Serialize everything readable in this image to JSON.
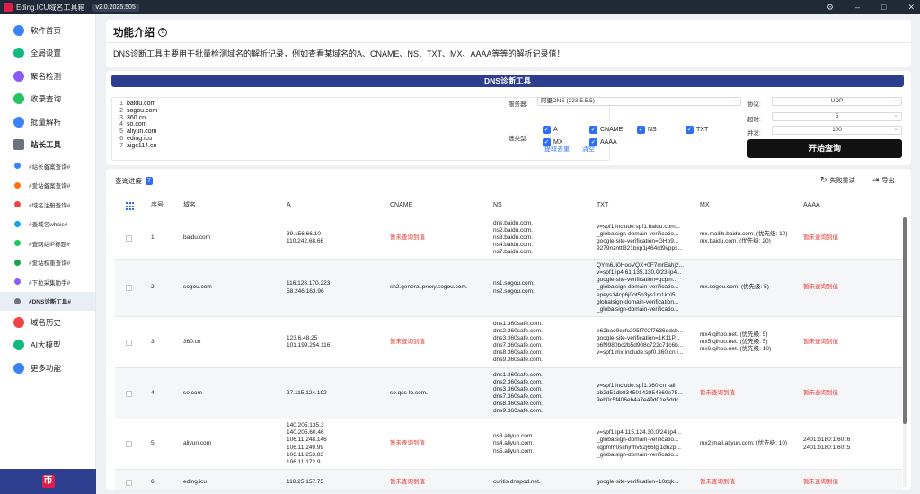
{
  "titlebar": {
    "title": "Eding.ICU域名工具箱",
    "version": "v2.0.2025.505"
  },
  "sidebar": {
    "items": [
      {
        "label": "软件首页",
        "color": "#3b82f6"
      },
      {
        "label": "全局设置",
        "color": "#10b981"
      },
      {
        "label": "聚名检测",
        "color": "#8b5cf6"
      },
      {
        "label": "收录查询",
        "color": "#22c55e"
      },
      {
        "label": "批量解析",
        "color": "#3b82f6"
      }
    ],
    "group_label": "站长工具",
    "subitems": [
      {
        "label": "#站长备案查询#",
        "color": "#3b82f6"
      },
      {
        "label": "#爱站备案查询#",
        "color": "#f97316"
      },
      {
        "label": "#域名注册查询#",
        "color": "#ef4444"
      },
      {
        "label": "#查域名whois#",
        "color": "#0ea5e9"
      },
      {
        "label": "#查网站IP标题#",
        "color": "#22c55e"
      },
      {
        "label": "#爱站权重查询#",
        "color": "#16a34a"
      },
      {
        "label": "#下拉采集助手#",
        "color": "#8b5cf6"
      },
      {
        "label": "#DNS诊断工具#",
        "color": "#6b7280"
      }
    ],
    "bottom_items": [
      {
        "label": "域名历史",
        "color": "#ef4444"
      },
      {
        "label": "AI大模型",
        "color": "#10b981"
      },
      {
        "label": "更多功能",
        "color": "#3b82f6"
      }
    ]
  },
  "intro": {
    "title": "功能介绍",
    "desc": "DNS诊断工具主要用于批量检测域名的解析记录，例如查看某域名的A、CNAME、NS、TXT、MX、AAAA等等的解析记录值！"
  },
  "tool": {
    "title": "DNS诊断工具",
    "line_numbers": [
      "1",
      "2",
      "3",
      "4",
      "5",
      "6",
      "7"
    ],
    "domains": [
      "baidu.com",
      "sogou.com",
      "360.cn",
      "so.com",
      "aliyun.com",
      "eding.icu",
      "aigc114.cn"
    ],
    "extract_label": "提取去重",
    "clear_label": "清空",
    "server_label": "服务器:",
    "server_value": "阿里DNS (223.5.5.5)",
    "protocol_label": "协议:",
    "protocol_value": "UDP",
    "timeout_label": "超时:",
    "timeout_value": "5",
    "concurrency_label": "并发:",
    "concurrency_value": "100",
    "record_type_label": "选类型:",
    "record_types": [
      "A",
      "CNAME",
      "NS",
      "TXT",
      "MX",
      "AAAA"
    ],
    "start_label": "开始查询"
  },
  "results": {
    "progress_label": "查询进度",
    "progress_count": "7",
    "retry_label": "失败重试",
    "export_label": "导出",
    "columns": [
      "序号",
      "域名",
      "A",
      "CNAME",
      "NS",
      "TXT",
      "MX",
      "AAAA"
    ],
    "rows": [
      {
        "idx": "1",
        "domain": "baidu.com",
        "a": [
          "39.156.66.10",
          "110.242.68.66"
        ],
        "cname": [
          "暂未查询到值"
        ],
        "ns": [
          "dns.baidu.com.",
          "ns2.baidu.com.",
          "ns3.baidu.com.",
          "ns4.baidu.com.",
          "ns7.baidu.com."
        ],
        "txt": [
          "v=spf1 include:spf1.baidu.com...",
          "_globalsign-domain-verificatio...",
          "google-site-verification=GHb9...",
          "9279nznttl321bxp1j464rd9vpps..."
        ],
        "mx": [
          "mx.maillb.baidu.com. (优先级: 10)",
          "mx.baidu.com. (优先级: 20)"
        ],
        "aaaa": [
          "暂未查询到值"
        ]
      },
      {
        "idx": "2",
        "domain": "sogou.com",
        "a": [
          "116.128.170.223",
          "58.246.163.96"
        ],
        "cname": [
          "sh2.general.proxy.sogou.com."
        ],
        "ns": [
          "ns1.sogou.com.",
          "ns2.sogou.com."
        ],
        "txt": [
          "QYm6Ji0HooVQX+0F7mrEahj2...",
          "v=spf1 ip4:61.135.130.0/23 ip4...",
          "google-site-verification=qcpm...",
          "_globalsign-domain-verificatio...",
          "epeys14cp6j0ot5h3ys1m1kol5...",
          "globalsign-domain-verification...",
          "_globalsign-domain-verificatio..."
        ],
        "mx": [
          "mx.sogou.com. (优先级: 5)"
        ],
        "aaaa": [
          "暂未查询到值"
        ]
      },
      {
        "idx": "3",
        "domain": "360.cn",
        "a": [
          "123.6.48.25",
          "101.199.254.116"
        ],
        "cname": [
          "暂未查询到值"
        ],
        "ns": [
          "dns1.360safe.com.",
          "dns2.360safe.com.",
          "dns3.360safe.com.",
          "dns7.360safe.com.",
          "dns8.360safe.com.",
          "dns9.360safe.com."
        ],
        "txt": [
          "e62bae9ccfc205f702f7636ddcb...",
          "google-site-verification=1K11P...",
          "b6f9980bc2b5d908c722c71c6b...",
          "v=spf1 mx include:spf0.360.cn i..."
        ],
        "mx": [
          "mx4.qihoo.net. (优先级: 5)",
          "mx5.qihoo.net. (优先级: 5)",
          "mx6.qihoo.net. (优先级: 10)"
        ],
        "aaaa": [
          "暂未查询到值"
        ]
      },
      {
        "idx": "4",
        "domain": "so.com",
        "a": [
          "27.115.124.192"
        ],
        "cname": [
          "so.qss-lb.com."
        ],
        "ns": [
          "dns1.360safe.com.",
          "dns2.360safe.com.",
          "dns3.360safe.com.",
          "dns7.360safe.com.",
          "dns8.360safe.com.",
          "dns9.360safe.com."
        ],
        "txt": [
          "v=spf1 include:spf1.360.cn -all",
          "bb2d51db83450142854660e75...",
          "9eb0c5f406eb4a7e49d01e5ddc..."
        ],
        "mx": [
          "暂未查询到值"
        ],
        "aaaa": [
          "暂未查询到值"
        ]
      },
      {
        "idx": "5",
        "domain": "aliyun.com",
        "a": [
          "140.205.135.3",
          "140.205.60.46",
          "106.11.248.146",
          "106.11.249.99",
          "106.11.253.83",
          "106.11.172.9"
        ],
        "cname": [
          "暂未查询到值"
        ],
        "ns": [
          "ns3.aliyun.com.",
          "ns4.aliyun.com.",
          "ns5.aliyun.com."
        ],
        "txt": [
          "v=spf1 ip4:115.124.30.0/24  ip4...",
          "_globalsign-domain-verificatio...",
          "kqpmfrf0schjrfhv52j66tgl1dn2p...",
          "_globalsign-domain-verificatio..."
        ],
        "mx": [
          "mx2.mail.aliyun.com. (优先级: 10)"
        ],
        "aaaa": [
          "2401:b180:1:60::6",
          "2401:b180:1:60::5"
        ]
      },
      {
        "idx": "6",
        "domain": "eding.icu",
        "a": [
          "118.25.157.75"
        ],
        "cname": [
          "暂未查询到值"
        ],
        "ns": [
          "curitis.dnspod.net."
        ],
        "txt": [
          "google-site-verification=10zqk..."
        ],
        "mx": [
          "暂未查询到值"
        ],
        "aaaa": [
          "暂未查询到值"
        ]
      }
    ]
  }
}
